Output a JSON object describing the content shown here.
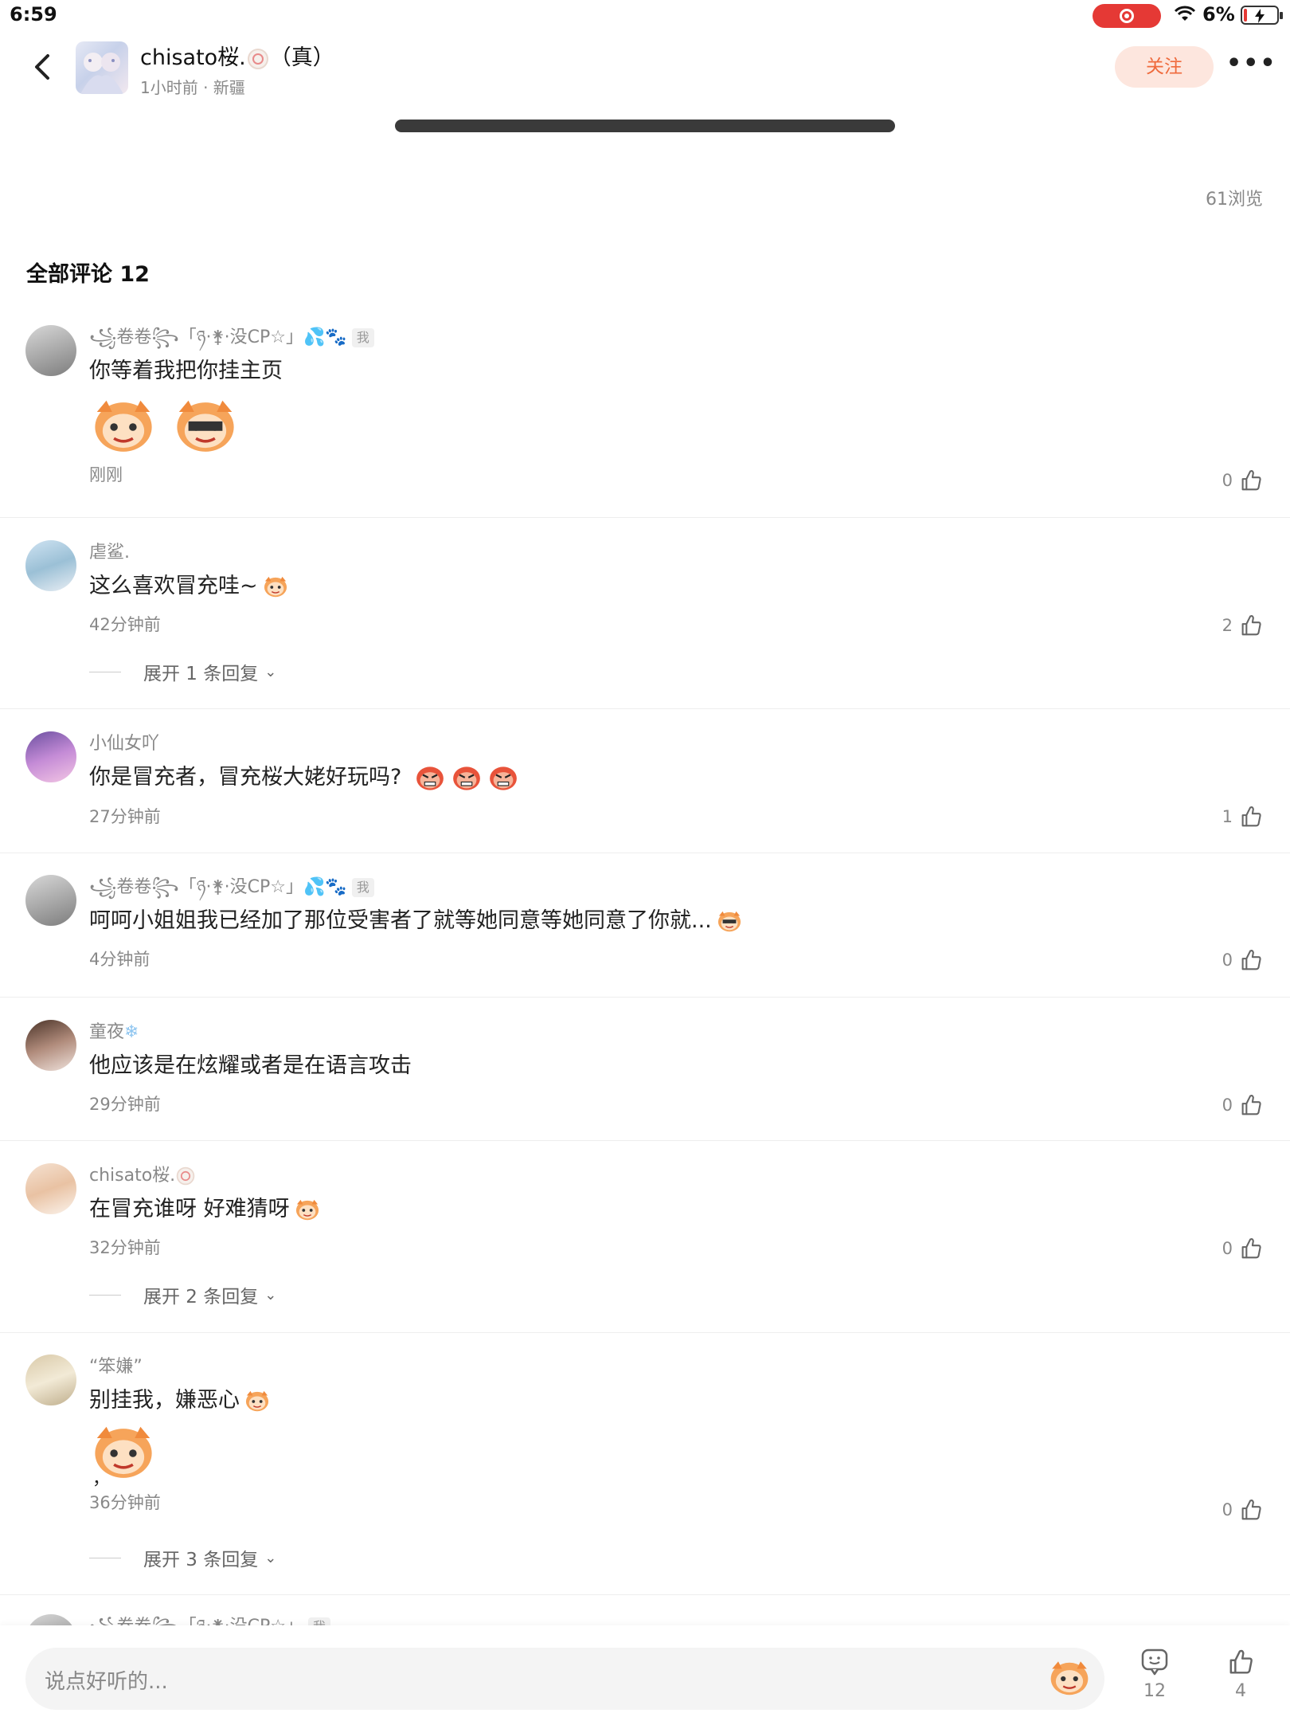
{
  "status_bar": {
    "time": "6:59",
    "battery": "6%"
  },
  "header": {
    "author_name": "chisato桜.",
    "author_suffix": "（真）",
    "meta": "1小时前 · 新疆",
    "follow_label": "关注",
    "more_label": "•••"
  },
  "views": "61浏览",
  "comments_title": "全部评论 12",
  "comments": [
    {
      "name": "꧁卷卷꧂「ཉ·⚵·没CP☆」💦🐾",
      "me_tag": "我",
      "text": "你等着我把你挂主页",
      "time": "刚刚",
      "likes": "0"
    },
    {
      "name": "虐鲨.",
      "text": "这么喜欢冒充哇~",
      "time": "42分钟前",
      "likes": "2",
      "expand": "展开 1 条回复"
    },
    {
      "name": "小仙女吖",
      "text": "你是冒充者，冒充桜大姥好玩吗?",
      "time": "27分钟前",
      "likes": "1"
    },
    {
      "name": "꧁卷卷꧂「ཉ·⚵·没CP☆」💦🐾",
      "me_tag": "我",
      "text": "呵呵小姐姐我已经加了那位受害者了就等她同意等她同意了你就...",
      "time": "4分钟前",
      "likes": "0"
    },
    {
      "name": "童夜",
      "text": "他应该是在炫耀或者是在语言攻击",
      "time": "29分钟前",
      "likes": "0"
    },
    {
      "name": "chisato桜.",
      "text": "在冒充谁呀 好难猜呀",
      "time": "32分钟前",
      "likes": "0",
      "expand": "展开 2 条回复"
    },
    {
      "name": "“笨嫌”",
      "text": "别挂我，嫌恶心",
      "extra": "，",
      "time": "36分钟前",
      "likes": "0",
      "expand": "展开 3 条回复"
    },
    {
      "name": "꧁卷卷꧂「ཉ·⚵·没CP☆」",
      "me_tag": "我"
    }
  ],
  "bottom": {
    "placeholder": "说点好听的...",
    "comment_count": "12",
    "like_count": "4"
  },
  "colors": {
    "accent": "#ef6a3c",
    "follow_bg": "#fde6de",
    "record": "#e53935"
  }
}
